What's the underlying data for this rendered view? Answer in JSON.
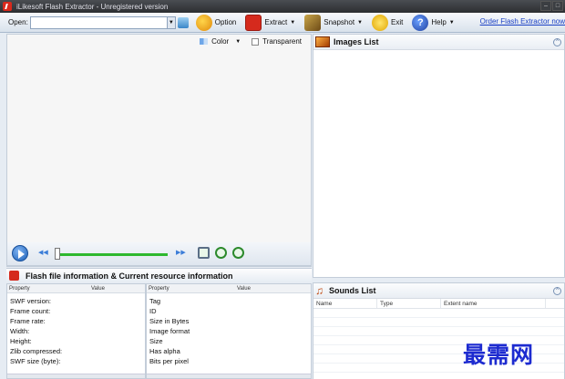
{
  "window": {
    "title": "iLikesoft Flash Extractor  -  Unregistered version"
  },
  "toolbar": {
    "open_label": "Open:",
    "open_value": "",
    "option_label": "Option",
    "extract_label": "Extract",
    "snapshot_label": "Snapshot",
    "exit_label": "Exit",
    "help_label": "Help",
    "order_link": "Order Flash Extractor now"
  },
  "preview": {
    "color_label": "Color",
    "transparent_label": "Transparent",
    "transparent_checked": false
  },
  "info": {
    "title": "Flash file information  &  Current resource information",
    "left_table": {
      "headers": [
        "Property",
        "Value"
      ],
      "rows": [
        "SWF version:",
        "Frame count:",
        "Frame rate:",
        "Width:",
        "Height:",
        "Zlib compressed:",
        "SWF size (byte):"
      ]
    },
    "right_table": {
      "headers": [
        "Property",
        "Value"
      ],
      "rows": [
        "Tag",
        "ID",
        "Size in Bytes",
        "Image format",
        "Size",
        "Has alpha",
        "Bits per pixel"
      ]
    }
  },
  "images": {
    "title": "Images List"
  },
  "sounds": {
    "title": "Sounds List",
    "headers": [
      "Name",
      "Type",
      "Extent name"
    ]
  },
  "watermark": {
    "text": "最需网"
  },
  "icons": {
    "app": "flash-extractor-app-icon",
    "option": "option-gear-icon",
    "extract": "extract-icon",
    "snapshot": "snapshot-icon",
    "exit": "exit-icon",
    "help": "help-icon",
    "play": "play-icon",
    "images": "images-list-icon",
    "sounds": "music-note-icon"
  },
  "colors": {
    "accent": "#1c5fb6",
    "slider": "#2eb82e",
    "link": "#1a3fc4"
  }
}
